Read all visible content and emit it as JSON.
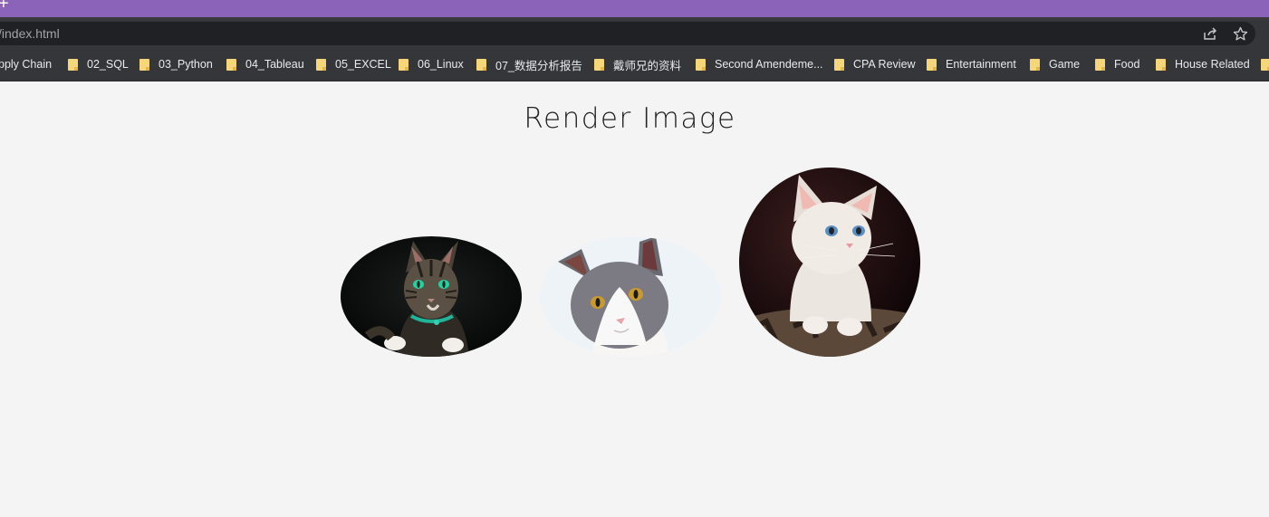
{
  "browser": {
    "url": "/index.html",
    "new_tab_symbol": "+"
  },
  "bookmarks": [
    {
      "label": "pply Chain",
      "folder": false
    },
    {
      "label": "02_SQL",
      "folder": true
    },
    {
      "label": "03_Python",
      "folder": true
    },
    {
      "label": "04_Tableau",
      "folder": true
    },
    {
      "label": "05_EXCEL",
      "folder": true
    },
    {
      "label": "06_Linux",
      "folder": true
    },
    {
      "label": "07_数据分析报告",
      "folder": true
    },
    {
      "label": "戴师兄的资料",
      "folder": true
    },
    {
      "label": "Second Amendeme...",
      "folder": true
    },
    {
      "label": "CPA Review",
      "folder": true
    },
    {
      "label": "Entertainment",
      "folder": true
    },
    {
      "label": "Game",
      "folder": true
    },
    {
      "label": "Food",
      "folder": true
    },
    {
      "label": "House Related",
      "folder": true
    }
  ],
  "page": {
    "title": "Render Image",
    "images": [
      {
        "name": "tabby-cat-image",
        "shape": "ellipse"
      },
      {
        "name": "gray-white-cat-image",
        "shape": "ellipse"
      },
      {
        "name": "white-kitten-image",
        "shape": "circle"
      }
    ]
  },
  "colors": {
    "tab_strip": "#8b63b8",
    "toolbar": "#35363a",
    "page_background": "#f4f4f4",
    "folder_icon": "#f5d77a"
  }
}
